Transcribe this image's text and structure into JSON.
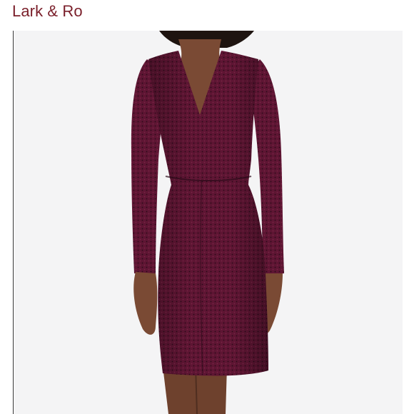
{
  "brand": {
    "name": "Lark & Ro",
    "color": "#7a1f2a"
  },
  "product_image": {
    "icon": "product-photo",
    "dress_color": "#5e1533",
    "skin_color": "#7a4a34",
    "background_color": "#f4f4f5"
  }
}
